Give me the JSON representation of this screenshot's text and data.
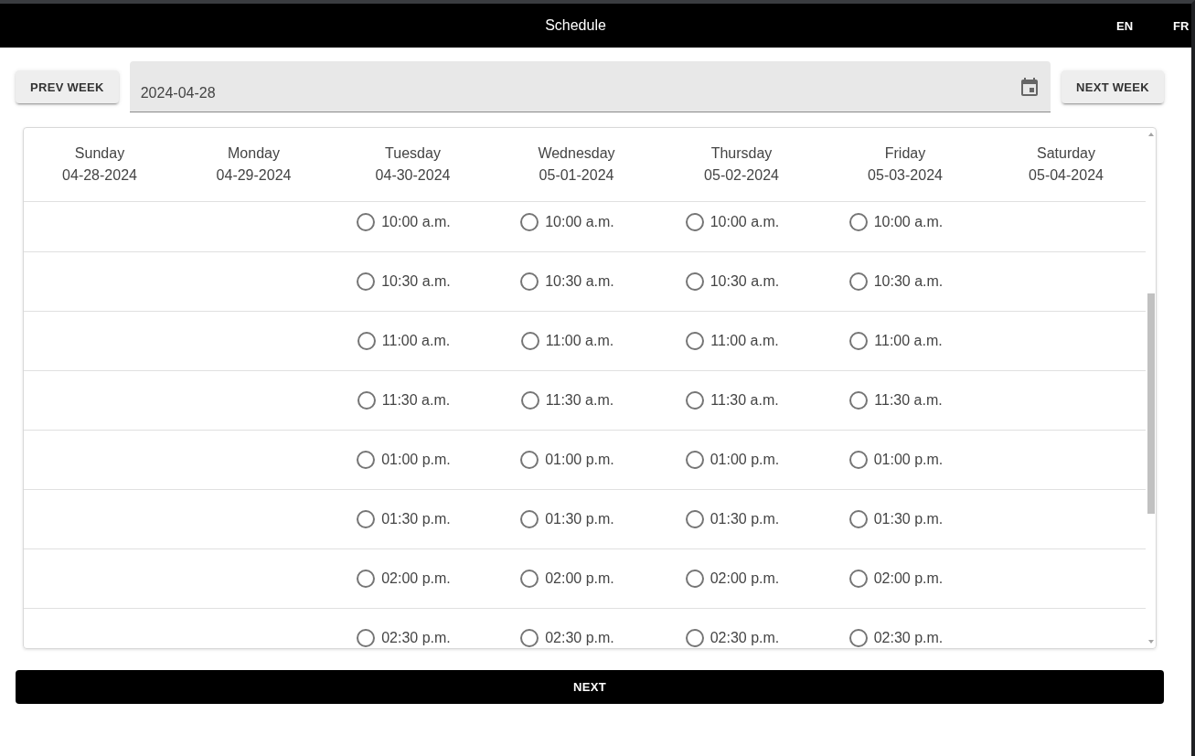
{
  "app_bar": {
    "title": "Schedule",
    "languages": [
      "EN",
      "FR"
    ]
  },
  "week_picker": {
    "prev_button": "PREV WEEK",
    "date_field": {
      "value": "2024-04-28"
    },
    "next_button": "NEXT WEEK"
  },
  "schedule": {
    "days": [
      {
        "name": "Sunday",
        "date": "04-28-2024"
      },
      {
        "name": "Monday",
        "date": "04-29-2024"
      },
      {
        "name": "Tuesday",
        "date": "04-30-2024",
        "slots": [
          {
            "time": "10:00 a.m.",
            "selected": false
          },
          {
            "time": "10:30 a.m.",
            "selected": false
          },
          {
            "time": "11:00 a.m.",
            "selected": false
          },
          {
            "time": "11:30 a.m.",
            "selected": false
          },
          {
            "time": "01:00 p.m.",
            "selected": false
          },
          {
            "time": "01:30 p.m.",
            "selected": false
          },
          {
            "time": "02:00 p.m.",
            "selected": false
          },
          {
            "time": "02:30 p.m.",
            "selected": false
          }
        ]
      },
      {
        "name": "Wednesday",
        "date": "05-01-2024",
        "slots": [
          {
            "time": "10:00 a.m.",
            "selected": false
          },
          {
            "time": "10:30 a.m.",
            "selected": false
          },
          {
            "time": "11:00 a.m.",
            "selected": false
          },
          {
            "time": "11:30 a.m.",
            "selected": false
          },
          {
            "time": "01:00 p.m.",
            "selected": false
          },
          {
            "time": "01:30 p.m.",
            "selected": false
          },
          {
            "time": "02:00 p.m.",
            "selected": false
          },
          {
            "time": "02:30 p.m.",
            "selected": false
          }
        ]
      },
      {
        "name": "Thursday",
        "date": "05-02-2024",
        "slots": [
          {
            "time": "10:00 a.m.",
            "selected": false
          },
          {
            "time": "10:30 a.m.",
            "selected": false
          },
          {
            "time": "11:00 a.m.",
            "selected": false
          },
          {
            "time": "11:30 a.m.",
            "selected": false
          },
          {
            "time": "01:00 p.m.",
            "selected": false
          },
          {
            "time": "01:30 p.m.",
            "selected": false
          },
          {
            "time": "02:00 p.m.",
            "selected": false
          },
          {
            "time": "02:30 p.m.",
            "selected": false
          }
        ]
      },
      {
        "name": "Friday",
        "date": "05-03-2024",
        "slots": [
          {
            "time": "10:00 a.m.",
            "selected": false
          },
          {
            "time": "10:30 a.m.",
            "selected": false
          },
          {
            "time": "11:00 a.m.",
            "selected": false
          },
          {
            "time": "11:30 a.m.",
            "selected": false
          },
          {
            "time": "01:00 p.m.",
            "selected": false
          },
          {
            "time": "01:30 p.m.",
            "selected": false
          },
          {
            "time": "02:00 p.m.",
            "selected": false
          },
          {
            "time": "02:30 p.m.",
            "selected": false
          }
        ]
      },
      {
        "name": "Saturday",
        "date": "05-04-2024"
      }
    ]
  },
  "next_button": "NEXT"
}
